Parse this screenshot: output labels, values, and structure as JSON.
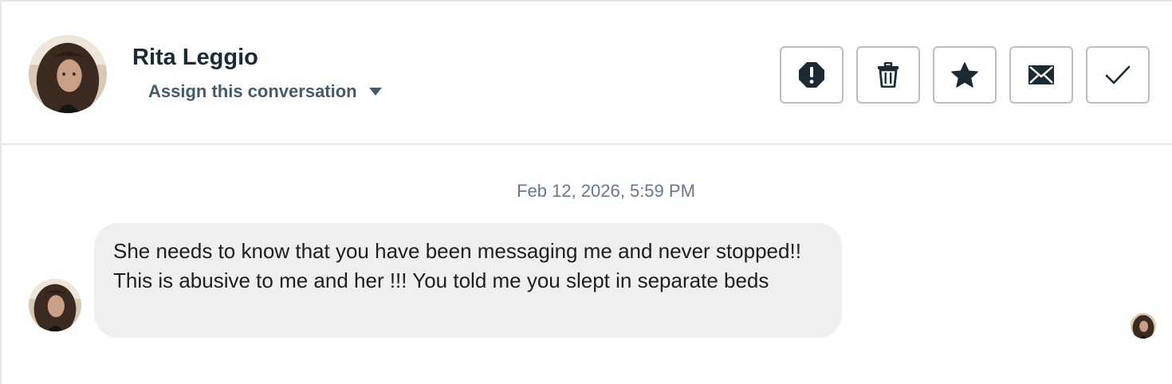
{
  "contact": {
    "name": "Rita Leggio",
    "assign_label": "Assign this conversation",
    "avatar": "profile-photo"
  },
  "toolbar": {
    "actions": [
      {
        "name": "report",
        "icon": "alert-octagon-icon"
      },
      {
        "name": "delete",
        "icon": "trash-icon"
      },
      {
        "name": "star",
        "icon": "star-icon"
      },
      {
        "name": "mark-unread",
        "icon": "envelope-icon"
      },
      {
        "name": "mark-done",
        "icon": "checkmark-icon"
      }
    ]
  },
  "thread": {
    "timestamp": "Feb 12, 2026, 5:59 PM",
    "messages": [
      {
        "sender": "Rita Leggio",
        "text": "She needs to know that you have been messaging me and never stopped!! This is abusive to me and her !!! You told me you slept in separate beds"
      }
    ],
    "read_receipt": "seen-avatar"
  },
  "colors": {
    "name_text": "#1c2b33",
    "secondary_text": "#465a69",
    "timestamp_text": "#67788a",
    "bubble_bg": "#efefef",
    "icon": "#1c2b33",
    "button_border": "#b8c0c8",
    "divider": "#e4e6e9"
  }
}
